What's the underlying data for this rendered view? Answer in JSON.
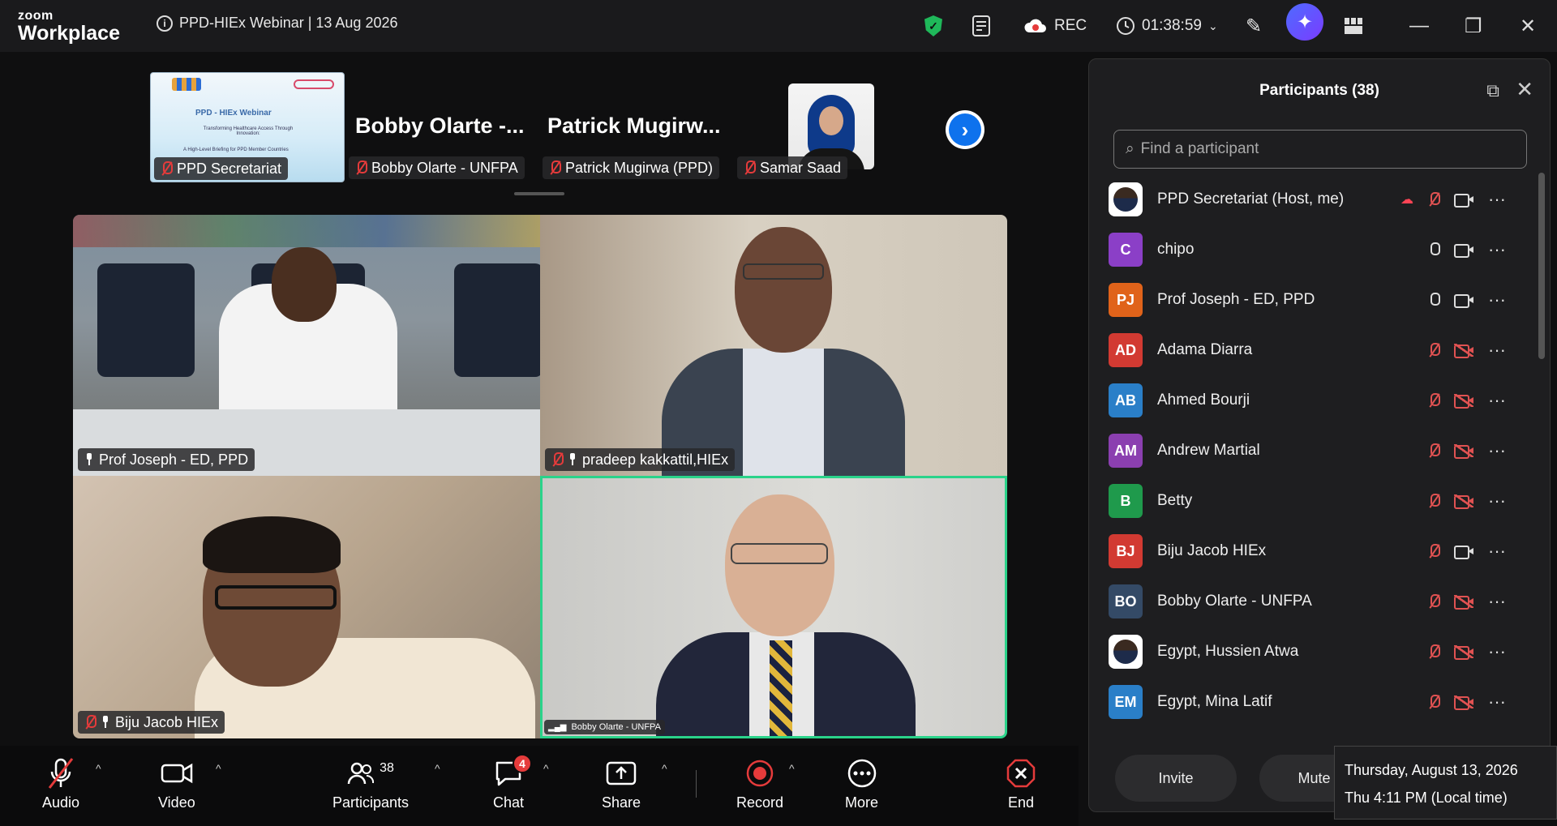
{
  "app": {
    "brand_top": "zoom",
    "brand_bottom": "Workplace",
    "meeting_title": "PPD-HIEx Webinar | 13 Aug 2026"
  },
  "topbar": {
    "rec_label": "REC",
    "timer": "01:38:59"
  },
  "strip": {
    "slide_title": "PPD - HIEx Webinar",
    "slide_subtitle": "Transforming Healthcare Access Through Innovation:",
    "slide_line": "A High-Level Briefing for PPD Member Countries",
    "tags": [
      "PPD Secretariat",
      "Bobby Olarte - UNFPA",
      "Patrick Mugirwa (PPD)",
      "Samar Saad"
    ],
    "names": [
      "Bobby Olarte -...",
      "Patrick Mugirw..."
    ]
  },
  "tiles": [
    {
      "name": "Prof Joseph - ED, PPD"
    },
    {
      "name": "pradeep kakkattil,HIEx"
    },
    {
      "name": "Biju Jacob HIEx"
    },
    {
      "name": "Bobby Olarte - UNFPA"
    }
  ],
  "toolbar": {
    "audio": "Audio",
    "video": "Video",
    "participants": "Participants",
    "participants_count": "38",
    "chat": "Chat",
    "chat_badge": "4",
    "share": "Share",
    "record": "Record",
    "more": "More",
    "end": "End"
  },
  "panel": {
    "title": "Participants (38)",
    "search_placeholder": "Find a participant",
    "participants": [
      {
        "name": "PPD Secretariat (Host, me)",
        "initials": "",
        "color": "#ffffff",
        "mic": "muted",
        "cam": "on"
      },
      {
        "name": "chipo",
        "initials": "C",
        "color": "#8b3fc7",
        "mic": "on",
        "cam": "on"
      },
      {
        "name": "Prof Joseph - ED, PPD",
        "initials": "PJ",
        "color": "#e0631a",
        "mic": "on",
        "cam": "on"
      },
      {
        "name": "Adama Diarra",
        "initials": "AD",
        "color": "#d23a32",
        "mic": "muted",
        "cam": "off"
      },
      {
        "name": "Ahmed Bourji",
        "initials": "AB",
        "color": "#2a7fc8",
        "mic": "muted",
        "cam": "off"
      },
      {
        "name": "Andrew Martial",
        "initials": "AM",
        "color": "#8b3fb0",
        "mic": "muted",
        "cam": "off"
      },
      {
        "name": "Betty",
        "initials": "B",
        "color": "#1f9a4c",
        "mic": "muted",
        "cam": "off"
      },
      {
        "name": "Biju Jacob HIEx",
        "initials": "BJ",
        "color": "#d23a32",
        "mic": "muted",
        "cam": "on"
      },
      {
        "name": "Bobby Olarte - UNFPA",
        "initials": "BO",
        "color": "#344a66",
        "mic": "muted",
        "cam": "off"
      },
      {
        "name": "Egypt, Hussien Atwa",
        "initials": "",
        "color": "#ffffff",
        "mic": "muted",
        "cam": "off"
      },
      {
        "name": "Egypt, Mina Latif",
        "initials": "EM",
        "color": "#2a7fc8",
        "mic": "muted",
        "cam": "off"
      }
    ],
    "invite_label": "Invite",
    "mute_label": "Mute a"
  },
  "tooltip": {
    "date": "Thursday, August 13, 2026",
    "time": "Thu 4:11 PM (Local time)"
  }
}
